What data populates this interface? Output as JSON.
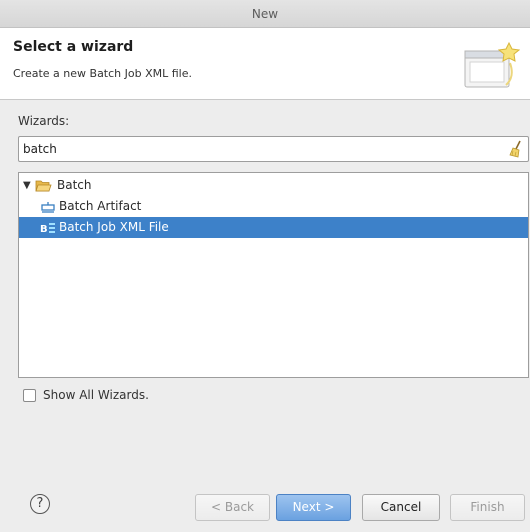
{
  "window": {
    "title": "New"
  },
  "header": {
    "title": "Select a wizard",
    "description": "Create a new Batch Job XML file."
  },
  "wizards_label": "Wizards:",
  "filter": {
    "value": "batch"
  },
  "tree": {
    "folder": {
      "label": "Batch",
      "expanded": true
    },
    "items": [
      {
        "label": "Batch Artifact",
        "icon": "batch-artifact-icon",
        "selected": false
      },
      {
        "label": "Batch Job XML File",
        "icon": "batch-job-xml-icon",
        "selected": true
      }
    ]
  },
  "show_all": {
    "label": "Show All Wizards.",
    "checked": false
  },
  "buttons": {
    "help": "?",
    "back": "< Back",
    "next": "Next >",
    "cancel": "Cancel",
    "finish": "Finish"
  },
  "colors": {
    "selection": "#3d81c9",
    "default_button": "#6aa1e0"
  }
}
